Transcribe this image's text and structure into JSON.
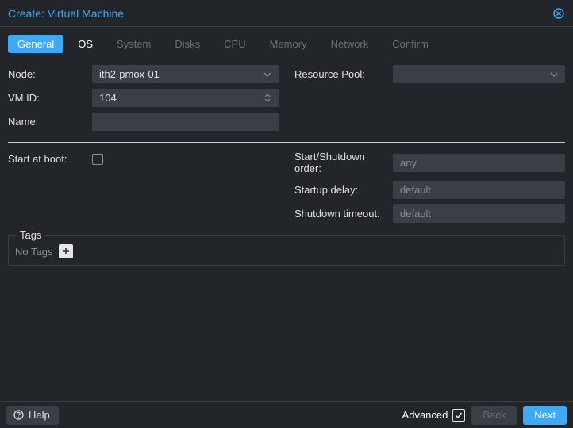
{
  "title": "Create: Virtual Machine",
  "tabs": [
    {
      "label": "General",
      "state": "active"
    },
    {
      "label": "OS",
      "state": "enabled"
    },
    {
      "label": "System",
      "state": "disabled"
    },
    {
      "label": "Disks",
      "state": "disabled"
    },
    {
      "label": "CPU",
      "state": "disabled"
    },
    {
      "label": "Memory",
      "state": "disabled"
    },
    {
      "label": "Network",
      "state": "disabled"
    },
    {
      "label": "Confirm",
      "state": "disabled"
    }
  ],
  "form": {
    "left": {
      "node_label": "Node:",
      "node_value": "ith2-pmox-01",
      "vmid_label": "VM ID:",
      "vmid_value": "104",
      "name_label": "Name:",
      "name_value": "",
      "startboot_label": "Start at boot:",
      "startboot_checked": false
    },
    "right": {
      "pool_label": "Resource Pool:",
      "pool_value": "",
      "order_label": "Start/Shutdown order:",
      "order_placeholder": "any",
      "startup_label": "Startup delay:",
      "startup_placeholder": "default",
      "shutdown_label": "Shutdown timeout:",
      "shutdown_placeholder": "default"
    }
  },
  "tags": {
    "legend": "Tags",
    "empty": "No Tags"
  },
  "footer": {
    "help": "Help",
    "advanced": "Advanced",
    "advanced_checked": true,
    "back": "Back",
    "next": "Next"
  }
}
